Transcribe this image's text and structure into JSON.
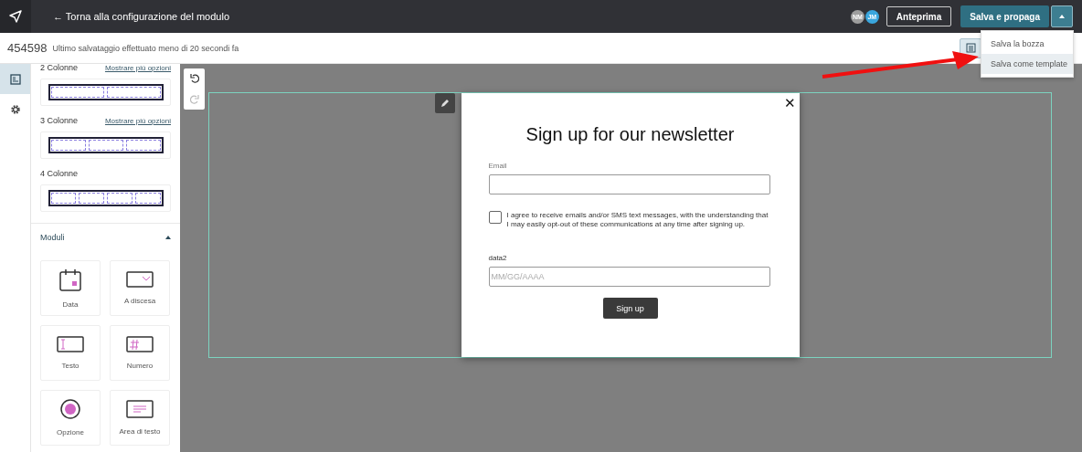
{
  "topbar": {
    "back_link": "← Torna alla configurazione del modulo",
    "avatars": [
      {
        "initials": "NM",
        "color": "#9e9e9e"
      },
      {
        "initials": "JM",
        "color": "#3aa6dd"
      }
    ],
    "preview_button": "Anteprima",
    "save_button": "Salva e propaga",
    "menu_expanded": true
  },
  "save_menu": [
    {
      "label": "Salva la bozza",
      "selected": false
    },
    {
      "label": "Salva come template",
      "selected": true
    }
  ],
  "subbar": {
    "form_id": "454598",
    "save_status": "Ultimo salvataggio effettuato meno di 20 secondi fa"
  },
  "rail": [
    {
      "kind": "form",
      "selected": true
    },
    {
      "kind": "settings",
      "selected": false
    }
  ],
  "layouts": [
    {
      "label": "2 Colonne",
      "link": "Mostrare più opzioni",
      "kind": "two"
    },
    {
      "label": "3 Colonne",
      "link": "Mostrare più opzioni",
      "kind": "three"
    },
    {
      "label": "4 Colonne",
      "kind": "four"
    }
  ],
  "modules_section": {
    "title": "Moduli",
    "expanded": true,
    "items": [
      {
        "kind": "date",
        "label": "Data"
      },
      {
        "kind": "dropdown",
        "label": "A discesa"
      },
      {
        "kind": "text",
        "label": "Testo"
      },
      {
        "kind": "number",
        "label": "Numero"
      },
      {
        "kind": "radio",
        "label": "Opzione"
      },
      {
        "kind": "textarea",
        "label": "Area di testo"
      }
    ]
  },
  "popup": {
    "close": "✕",
    "title": "Sign up for our newsletter",
    "email_label": "Email",
    "consent": "I agree to receive emails and/or SMS text messages, with the understanding that I may easily opt-out of these communications at any time after signing up.",
    "consent_checked": false,
    "date_label": "data2",
    "date_placeholder": "MM/GG/AAAA",
    "submit": "Sign up"
  }
}
